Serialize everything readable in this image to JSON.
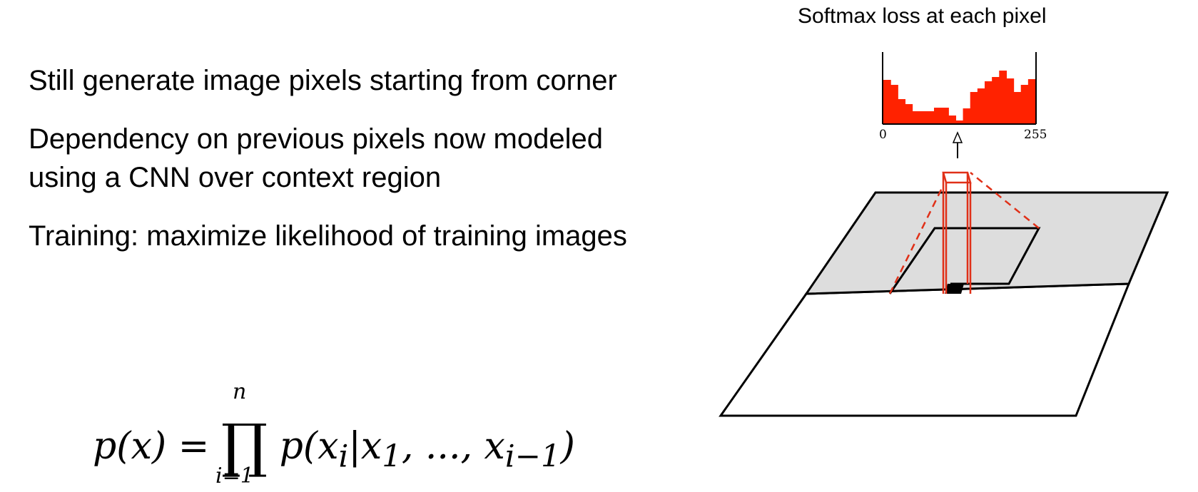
{
  "bullets": [
    "Still generate image pixels starting from corner",
    "Dependency on previous pixels now modeled using a CNN over context region",
    "Training: maximize likelihood of training images"
  ],
  "formula": {
    "lhs": "p(x) =",
    "operator": "∏",
    "upper": "n",
    "lower": "i=1",
    "rhs": "p(x",
    "rhs_sub_i": "i",
    "rhs_mid": "|x",
    "rhs_sub_1": "1",
    "rhs_dots": ", ..., x",
    "rhs_sub_last": "i−1",
    "rhs_close": ")"
  },
  "diagram": {
    "caption": "Softmax loss at each pixel",
    "histogram_min_label": "0",
    "histogram_max_label": "255",
    "histogram_color": "#ff2200",
    "histogram_levels": [
      0.62,
      0.55,
      0.35,
      0.28,
      0.18,
      0.18,
      0.18,
      0.23,
      0.23,
      0.12,
      0.05,
      0.22,
      0.45,
      0.5,
      0.6,
      0.66,
      0.75,
      0.64,
      0.45,
      0.55,
      0.63
    ],
    "context_color": "#e03018",
    "region_fill": "#dddddd"
  }
}
